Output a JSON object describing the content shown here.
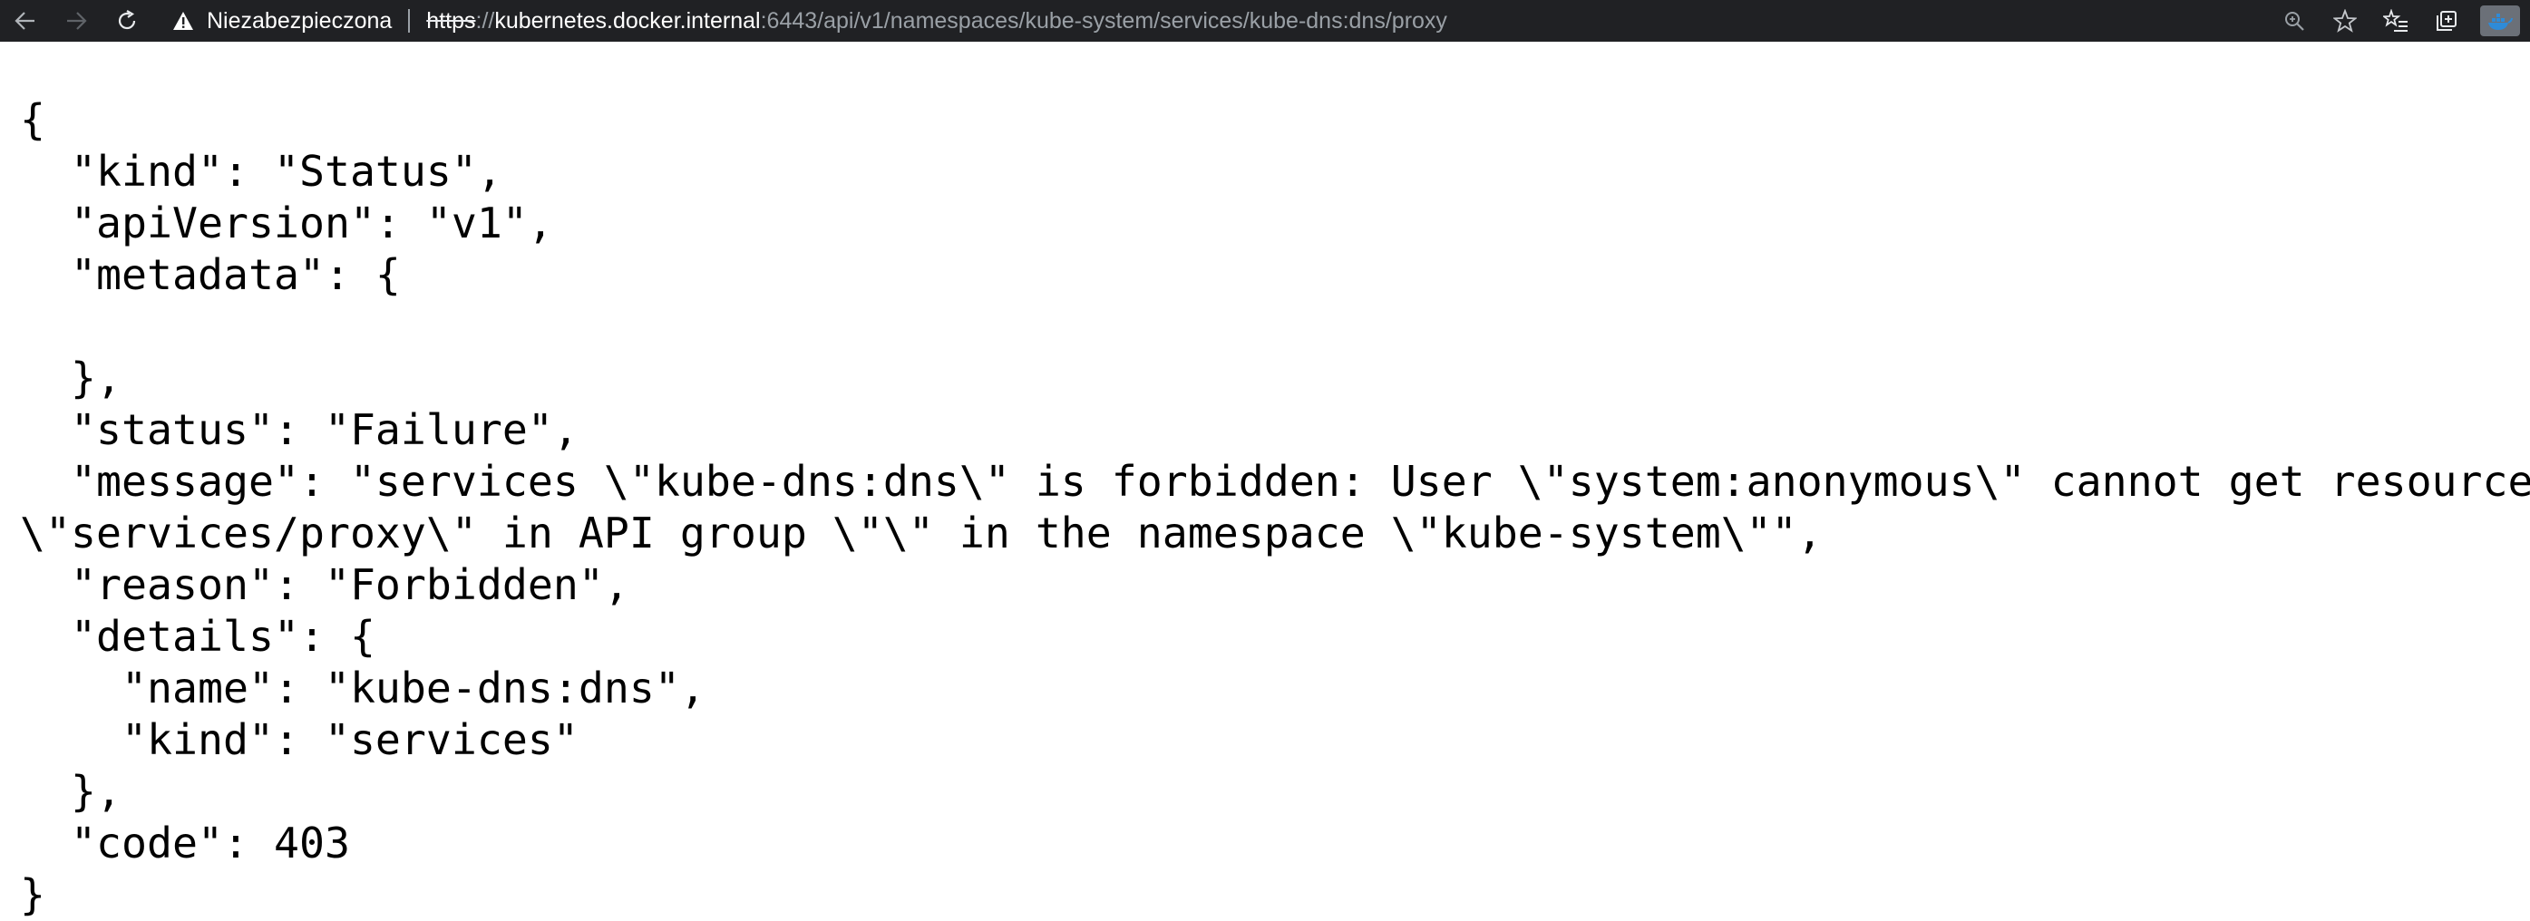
{
  "browser": {
    "security_label": "Niezabezpieczona",
    "url_scheme": "https",
    "url_slashes": "://",
    "url_host": "kubernetes.docker.internal",
    "url_rest": ":6443/api/v1/namespaces/kube-system/services/kube-dns:dns/proxy",
    "icons": {
      "back": "arrow-left-icon",
      "forward": "arrow-right-icon",
      "refresh": "refresh-icon",
      "warning": "warning-triangle-icon",
      "zoom": "zoom-icon",
      "favorite": "star-icon",
      "favorites": "favorites-list-icon",
      "collections": "collections-icon",
      "profile": "profile-avatar-icon"
    },
    "colors": {
      "toolbar_bg": "#202124",
      "url_dim": "#9aa0a6",
      "url_bright": "#ffffff"
    }
  },
  "json_lines": [
    "{",
    "  \"kind\": \"Status\",",
    "  \"apiVersion\": \"v1\",",
    "  \"metadata\": {",
    "",
    "  },",
    "  \"status\": \"Failure\",",
    "  \"message\": \"services \\\"kube-dns:dns\\\" is forbidden: User \\\"system:anonymous\\\" cannot get resource",
    "\\\"services/proxy\\\" in API group \\\"\\\" in the namespace \\\"kube-system\\\"\",",
    "  \"reason\": \"Forbidden\",",
    "  \"details\": {",
    "    \"name\": \"kube-dns:dns\",",
    "    \"kind\": \"services\"",
    "  },",
    "  \"code\": 403",
    "}"
  ]
}
